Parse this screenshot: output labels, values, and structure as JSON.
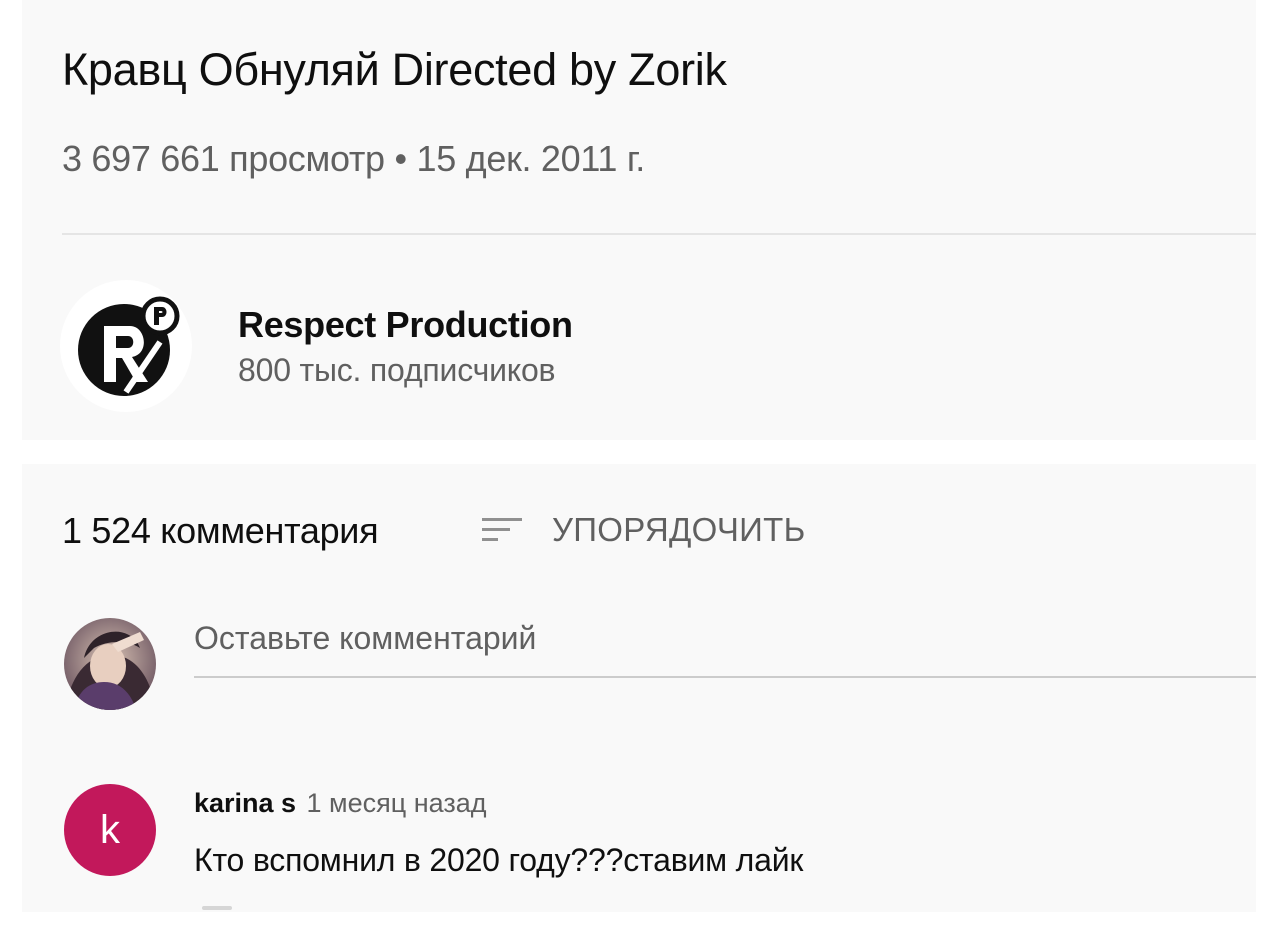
{
  "video": {
    "title": "Кравц Обнуляй Directed by Zorik",
    "meta": "3 697 661 просмотр • 15 дек. 2011 г."
  },
  "channel": {
    "name": "Respect Production",
    "subscribers": "800 тыс. подписчиков",
    "logo_icon": "respect-production-logo-icon"
  },
  "comments": {
    "count_label": "1 524 комментария",
    "sort_label": "УПОРЯДОЧИТЬ",
    "sort_icon": "sort-icon",
    "input_placeholder": "Оставьте комментарий",
    "items": [
      {
        "author": "karina s",
        "time": "1 месяц назад",
        "avatar_letter": "k",
        "avatar_color": "#c2185b",
        "text": "Кто вспомнил в 2020 году???ставим лайк"
      }
    ]
  },
  "colors": {
    "panel_bg": "#f9f9f9",
    "primary_text": "#0f0f0f",
    "secondary_text": "#606060"
  }
}
